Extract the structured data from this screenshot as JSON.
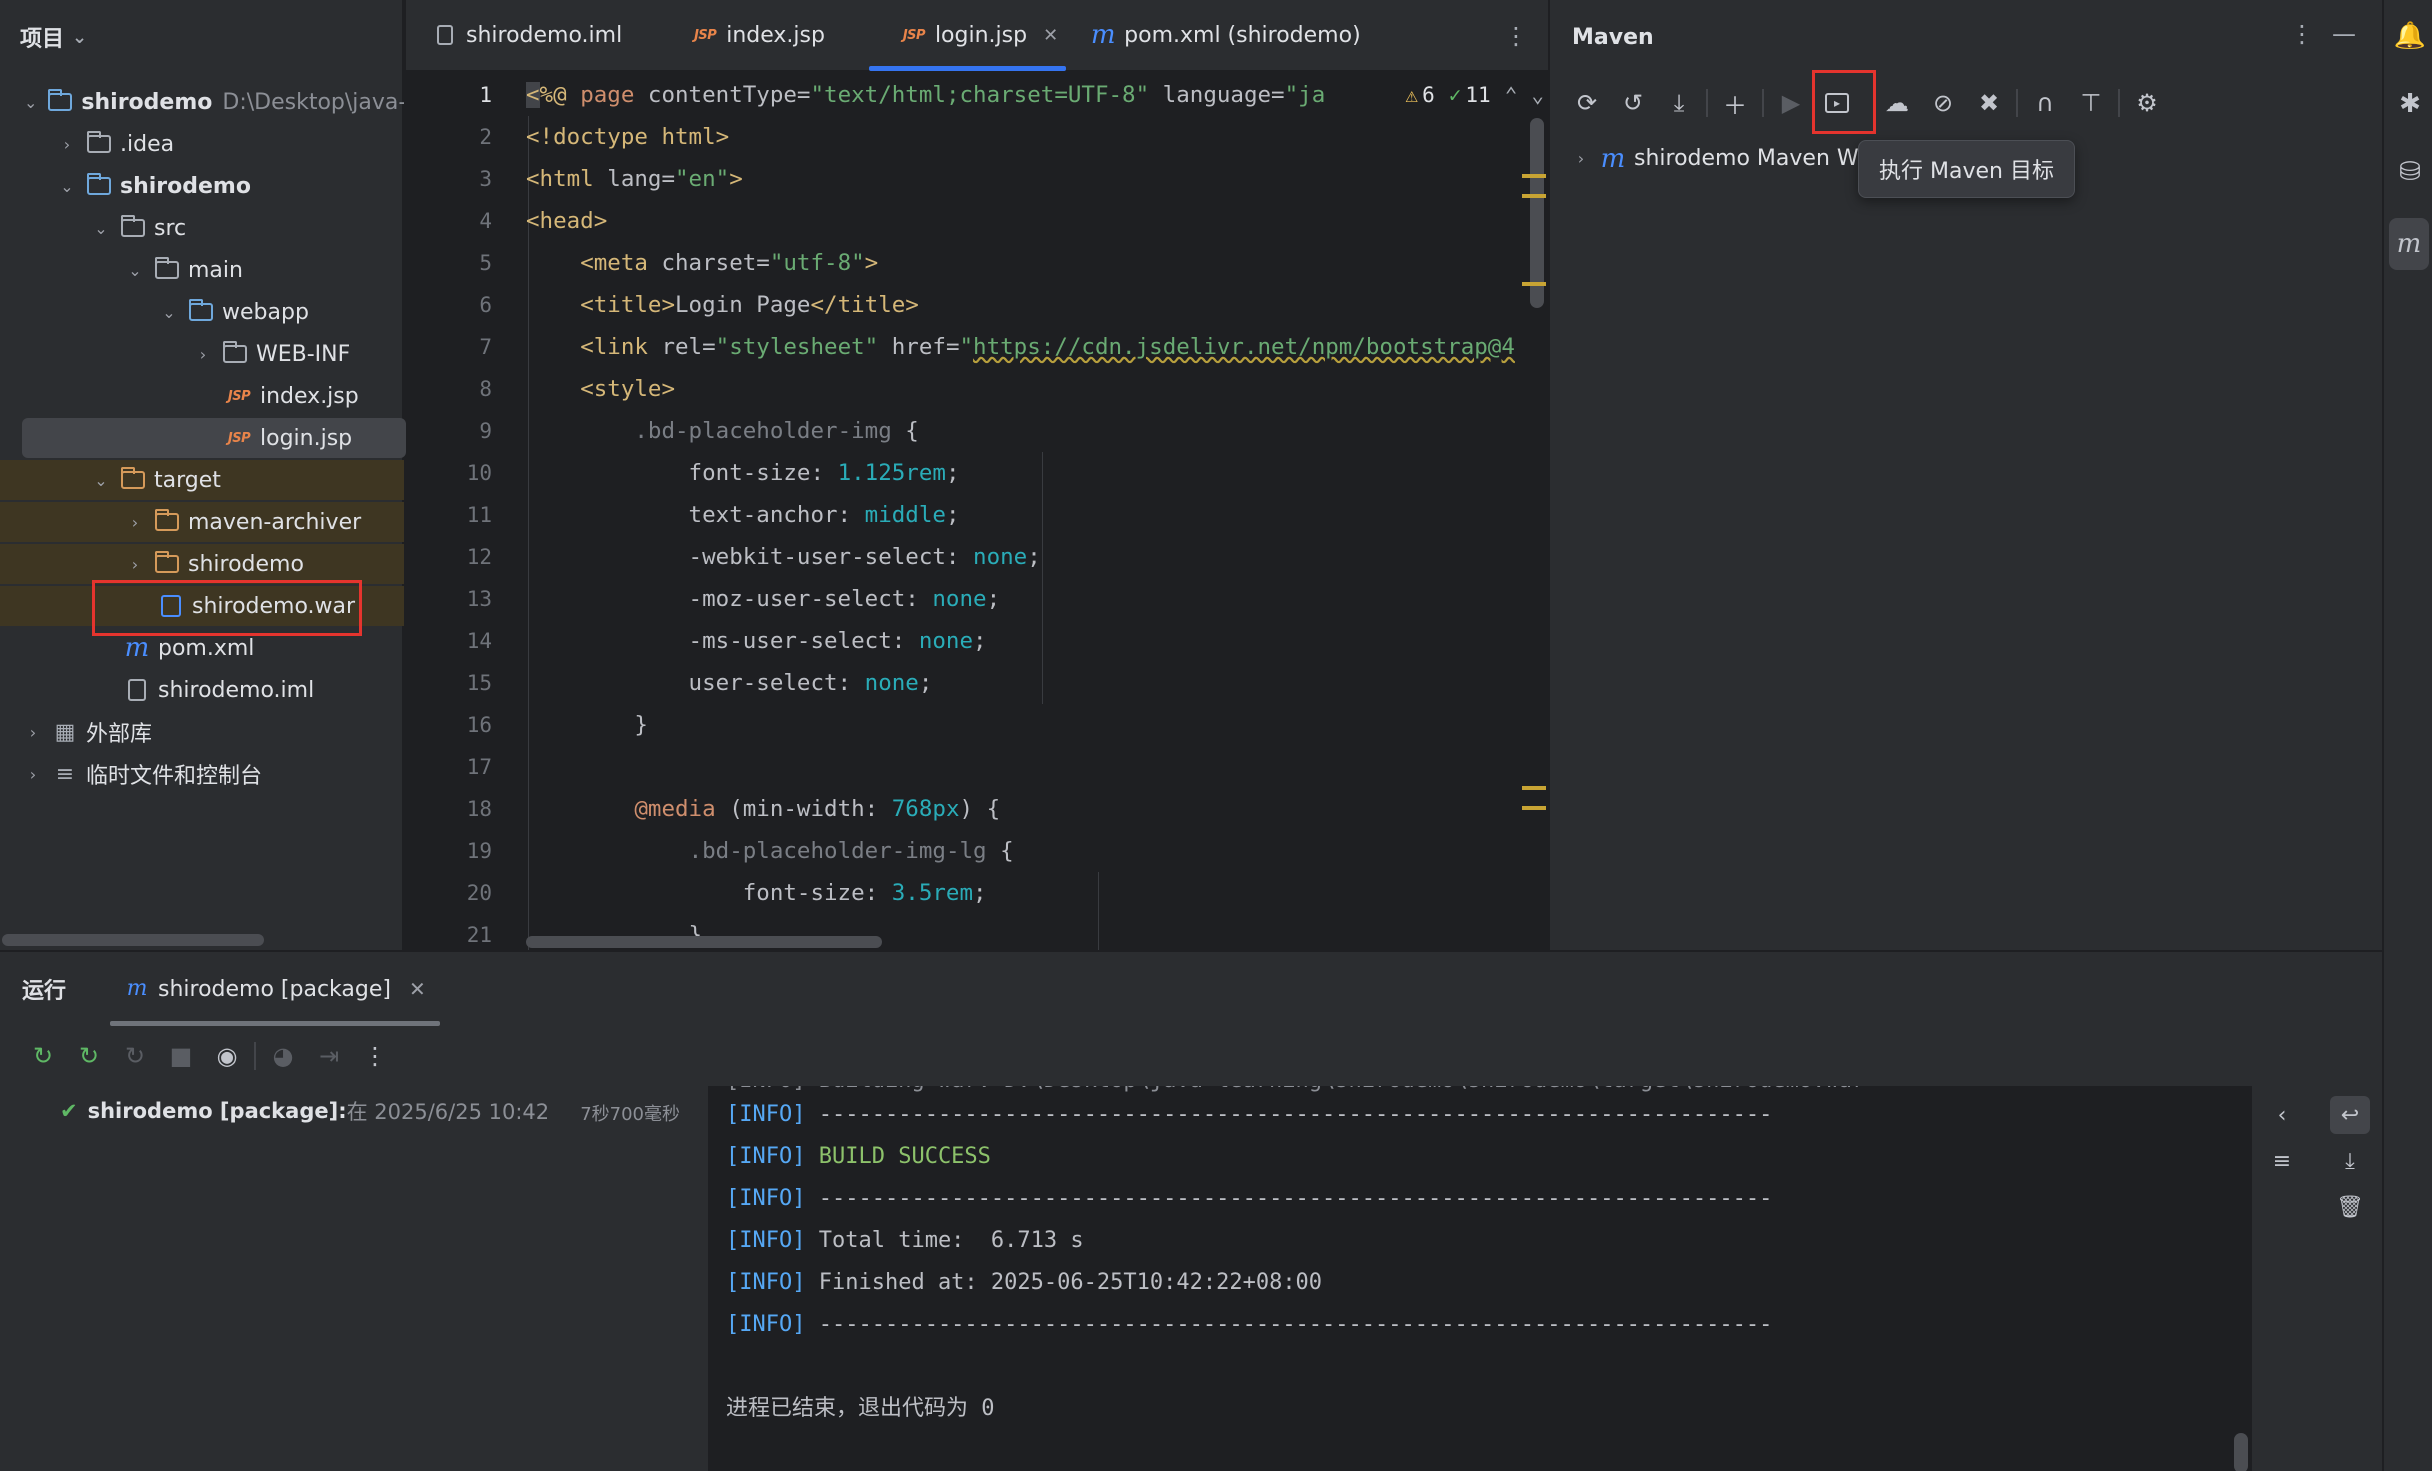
{
  "project": {
    "title": "项目",
    "items": [
      {
        "label": "shirodemo",
        "extra": "D:\\Desktop\\java-le"
      },
      {
        "label": ".idea"
      },
      {
        "label": "shirodemo"
      },
      {
        "label": "src"
      },
      {
        "label": "main"
      },
      {
        "label": "webapp"
      },
      {
        "label": "WEB-INF"
      },
      {
        "label": "index.jsp"
      },
      {
        "label": "login.jsp"
      },
      {
        "label": "target"
      },
      {
        "label": "maven-archiver"
      },
      {
        "label": "shirodemo"
      },
      {
        "label": "shirodemo.war"
      },
      {
        "label": "pom.xml"
      },
      {
        "label": "shirodemo.iml"
      },
      {
        "label": "外部库"
      },
      {
        "label": "临时文件和控制台"
      }
    ]
  },
  "tabs": [
    {
      "label": "shirodemo.iml"
    },
    {
      "label": "index.jsp"
    },
    {
      "label": "login.jsp"
    },
    {
      "label": "pom.xml (shirodemo)"
    }
  ],
  "editor": {
    "warnings": "6",
    "checks": "11",
    "line_numbers": [
      "1",
      "2",
      "3",
      "4",
      "5",
      "6",
      "7",
      "8",
      "9",
      "10",
      "11",
      "12",
      "13",
      "14",
      "15",
      "16",
      "17",
      "18",
      "19",
      "20",
      "21"
    ]
  },
  "maven": {
    "title": "Maven",
    "node_label": "shirodemo Maven We",
    "tooltip": "执行 Maven 目标"
  },
  "run": {
    "title": "运行",
    "tab_label": "shirodemo [package]",
    "tree_item_bold": "shirodemo [package]:",
    "tree_item_detail": " 在 2025/6/25 10:42",
    "tree_item_time": "7秒700毫秒",
    "console": {
      "partial_top": "[INFO] Building war: D:\\Desktop\\java-learning\\shirodemo\\shirodemo\\target\\shirodemo.war",
      "tag": "[INFO]",
      "dashes": "------------------------------------------------------------------------",
      "build_success": "BUILD SUCCESS",
      "total_time": "Total time:  6.713 s",
      "finished_at": "Finished at: 2025-06-25T10:42:22+08:00",
      "exit_msg": "进程已结束，退出代码为 0"
    }
  },
  "colors": {
    "accent": "#3574f0",
    "highlight_box": "#e5342e",
    "success": "#8dc26b"
  }
}
